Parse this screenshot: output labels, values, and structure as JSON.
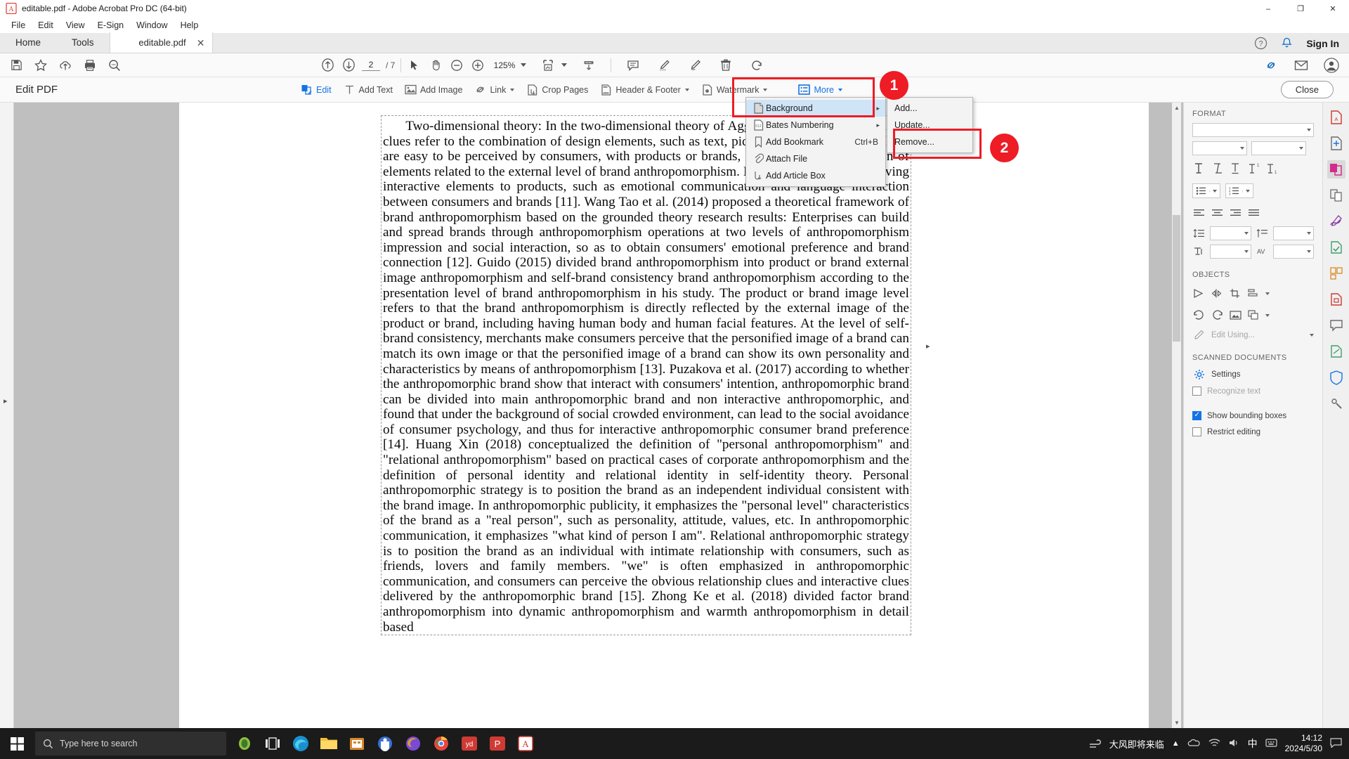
{
  "window": {
    "title": "editable.pdf - Adobe Acrobat Pro DC (64-bit)",
    "minimize": "–",
    "maximize": "❐",
    "close": "✕"
  },
  "menubar": {
    "items": [
      "File",
      "Edit",
      "View",
      "E-Sign",
      "Window",
      "Help"
    ]
  },
  "tabs": {
    "home": "Home",
    "tools": "Tools",
    "document": "editable.pdf",
    "close_tab": "✕",
    "sign_in": "Sign In"
  },
  "toolbar": {
    "left_icons": [
      "save-icon",
      "star-icon",
      "upload-cloud-icon",
      "print-icon",
      "search-icon"
    ],
    "page_current": "2",
    "page_total": "/ 7",
    "zoom_level": "125%",
    "right_icons": [
      "comment-icon",
      "highlight-icon",
      "draw-icon",
      "delete-icon",
      "rotate-icon",
      "attach-link-icon",
      "email-icon",
      "account-icon"
    ]
  },
  "editbar": {
    "title": "Edit PDF",
    "tools": [
      {
        "label": "Edit",
        "icon": "edit-icon",
        "active": true,
        "caret": false
      },
      {
        "label": "Add Text",
        "icon": "add-text-icon",
        "active": false,
        "caret": false
      },
      {
        "label": "Add Image",
        "icon": "add-image-icon",
        "active": false,
        "caret": false
      },
      {
        "label": "Link",
        "icon": "link-icon",
        "active": false,
        "caret": true
      },
      {
        "label": "Crop Pages",
        "icon": "crop-pages-icon",
        "active": false,
        "caret": false
      },
      {
        "label": "Header & Footer",
        "icon": "header-footer-icon",
        "active": false,
        "caret": true
      },
      {
        "label": "Watermark",
        "icon": "watermark-icon",
        "active": false,
        "caret": true
      },
      {
        "label": "More",
        "icon": "more-icon",
        "active": true,
        "caret": true
      }
    ],
    "close_label": "Close"
  },
  "more_menu": {
    "items": [
      {
        "label": "Background",
        "icon": "background-icon",
        "submenu": true,
        "shortcut": "",
        "highlighted": true
      },
      {
        "label": "Bates Numbering",
        "icon": "bates-numbering-icon",
        "submenu": true,
        "shortcut": "",
        "highlighted": false
      },
      {
        "label": "Add Bookmark",
        "icon": "bookmark-icon",
        "submenu": false,
        "shortcut": "Ctrl+B",
        "highlighted": false
      },
      {
        "label": "Attach File",
        "icon": "attach-file-icon",
        "submenu": false,
        "shortcut": "",
        "highlighted": false
      },
      {
        "label": "Add Article Box",
        "icon": "article-box-icon",
        "submenu": false,
        "shortcut": "",
        "highlighted": false
      }
    ]
  },
  "background_submenu": {
    "items": [
      "Add...",
      "Update...",
      "Remove..."
    ]
  },
  "annotations": {
    "badge_1": "1",
    "badge_2": "2",
    "color": "#ee1c25"
  },
  "document": {
    "body": "      Two-dimensional theory: In the two-dimensional theory of Aggarwal (2007), impressionistic clues refer to the combination of design elements, such as text, pictures, audio and video, which are easy to be perceived by consumers, with products or brands, focusing on the expression of elements related to the external level of brand anthropomorphism. Interactive cues refer to giving interactive elements to products, such as emotional communication and language interaction between consumers and brands [11]. Wang Tao et al. (2014) proposed a theoretical framework of brand anthropomorphism based on the grounded theory research results: Enterprises can build and spread brands through anthropomorphism operations at two levels of anthropomorphism impression and social interaction, so as to obtain consumers' emotional preference and brand connection [12]. Guido (2015) divided brand anthropomorphism into product or brand external image anthropomorphism and self-brand consistency brand anthropomorphism according to the presentation level of brand anthropomorphism in his study. The product or brand image level refers to that the brand anthropomorphism is directly reflected by the external image of the product or brand, including having human body and human facial features. At the level of self-brand consistency, merchants make consumers perceive that the personified image of a brand can match its own image or that the personified image of a brand can show its own personality and characteristics by means of anthropomorphism [13]. Puzakova et al. (2017) according to whether the anthropomorphic brand show that interact with consumers' intention, anthropomorphic brand can be divided into main anthropomorphic brand and non interactive anthropomorphic, and found that under the background of social crowded environment, can lead to the social avoidance of consumer psychology, and thus for interactive anthropomorphic consumer brand preference [14]. Huang Xin (2018) conceptualized the definition of \"personal anthropomorphism\" and \"relational anthropomorphism\" based on practical cases of corporate anthropomorphism and the definition of personal identity and relational identity in self-identity theory. Personal anthropomorphic strategy is to position the brand as an independent individual consistent with the brand image. In anthropomorphic publicity, it emphasizes the \"personal level\" characteristics of the brand as a \"real person\", such as personality, attitude, values, etc. In anthropomorphic communication, it emphasizes \"what kind of person I am\". Relational anthropomorphic strategy is to position the brand as an individual with intimate relationship with consumers, such as friends, lovers and family members. \"we\" is often emphasized in anthropomorphic communication, and consumers can perceive the obvious relationship clues and interactive clues delivered by the anthropomorphic brand [15]. Zhong Ke et al. (2018) divided factor brand anthropomorphism into dynamic anthropomorphism and warmth anthropomorphism in detail based"
  },
  "right_panel": {
    "format_title": "FORMAT",
    "objects_title": "OBJECTS",
    "scanned_title": "SCANNED DOCUMENTS",
    "settings_label": "Settings",
    "edit_using_label": "Edit Using...",
    "recognize_text_label": "Recognize text",
    "show_bounding_boxes_label": "Show bounding boxes",
    "restrict_editing_label": "Restrict editing",
    "show_bounding_boxes_checked": true,
    "restrict_editing_checked": false,
    "recognize_text_checked": false
  },
  "icon_rail": {
    "icons": [
      "export-pdf-icon",
      "create-pdf-icon",
      "edit-pdf-icon",
      "combine-files-icon",
      "fill-sign-icon",
      "comment-icon",
      "organize-pages-icon",
      "comment-bubble-icon",
      "send-for-review-icon",
      "protect-icon",
      "more-tools-icon"
    ]
  },
  "taskbar": {
    "search_placeholder": "Type here to search",
    "ime_text": "大风即将来临",
    "lang": "中",
    "time": "14:12",
    "date": "2024/5/30",
    "apps": [
      "task-view-icon",
      "edge-icon",
      "file-explorer-icon",
      "store-icon",
      "teams-icon",
      "firefox-icon",
      "chrome-icon",
      "yd-icon",
      "p-icon",
      "acrobat-icon"
    ]
  }
}
